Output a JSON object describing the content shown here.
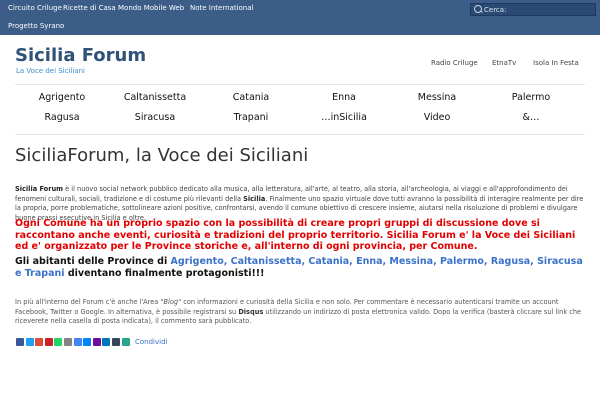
{
  "topbar": {
    "links": [
      "Circuito Criluge",
      "Ricette di Casa",
      "Mondo Mobile Web",
      "Note International",
      "Progetto Syrano"
    ],
    "search_placeholder": "Cerca:"
  },
  "header": {
    "title": "Sicilia Forum",
    "tagline": "La Voce dei Siciliani",
    "secondary_links": [
      "Radio Criluge",
      "EtnaTv",
      "Isola In Festa"
    ]
  },
  "nav": {
    "row1": [
      "Agrigento",
      "Caltanissetta",
      "Catania",
      "Enna",
      "Messina",
      "Palermo"
    ],
    "row2": [
      "Ragusa",
      "Siracusa",
      "Trapani",
      "…inSicilia",
      "Video",
      "&…"
    ]
  },
  "content": {
    "title": "SiciliaForum, la Voce dei Siciliani",
    "p1_bold": "Sicilia Forum",
    "p1_a": " è il nuovo social network pubblico dedicato alla musica, alla letteratura, all'arte, al teatro, alla storia, all'archeologia, ai viaggi e all'approfondimento dei fenomeni culturali, sociali, tradizione e di costume più rilevanti della ",
    "p1_bold2": "Sicilia",
    "p1_b": ". Finalmente uno spazio virtuale dove tutti avranno la possibilità di interagire realmente per dire la propria, porre problematiche, sottolineare azioni positive, confrontarsi, avendo il comune obiettivo di crescere insieme, aiutarsi nella risoluzione di problemi e divulgare buone prassi esecutive in Sicilia e oltre.",
    "red_text": "Ogni Comune ha un proprio spazio con la possibilità di creare propri gruppi di discussione dove si raccontano anche eventi, curiosità e tradizioni del proprio territorio. Sicilia Forum e' la Voce dei Siciliani ed e' organizzato per le Province storiche e, all'interno di ogni provincia, per Comune.",
    "black_prefix": "Gli abitanti delle Province di ",
    "provinces": "Agrigento, Caltanissetta, Catania, Enna, Messina, Palermo, Ragusa, Siracusa e Trapani",
    "black_suffix": " diventano finalmente protagonisti!!!",
    "p2_a": "In più all'interno del Forum c'è anche l'Area \"",
    "p2_blog": "Blog",
    "p2_b": "\" con informazioni e curiosità della Sicilia e non solo. Per commentare è necessario autenticarsi tramite un account Facebook, Twitter o Google. In alternativa, è possibile registrarsi su ",
    "p2_disqus": "Disqus",
    "p2_c": " utilizzando un indirizzo di posta elettronica valido. Dopo la verifica (basterà cliccare sul link che riceverete nella casella di posta indicata), il commento sarà pubblicato."
  },
  "share": {
    "label": "Condividi",
    "icons": [
      {
        "name": "facebook-icon",
        "color": "#3b5998"
      },
      {
        "name": "twitter-icon",
        "color": "#1da1f2"
      },
      {
        "name": "google-plus-icon",
        "color": "#dd4b39"
      },
      {
        "name": "pinterest-icon",
        "color": "#cb2027"
      },
      {
        "name": "whatsapp-icon",
        "color": "#25d366"
      },
      {
        "name": "email-icon",
        "color": "#848484"
      },
      {
        "name": "google-icon",
        "color": "#4285f4"
      },
      {
        "name": "messenger-icon",
        "color": "#0084ff"
      },
      {
        "name": "yahoo-icon",
        "color": "#720e9e"
      },
      {
        "name": "linkedin-icon",
        "color": "#0077b5"
      },
      {
        "name": "tumblr-icon",
        "color": "#35465c"
      },
      {
        "name": "share-plus-icon",
        "color": "#2ca58d"
      }
    ]
  },
  "colors": {
    "topbar": "#3b5d88",
    "title": "#2f5278",
    "accent": "#3d8fd0",
    "red": "#e30000",
    "link_blue": "#3a72c8"
  }
}
